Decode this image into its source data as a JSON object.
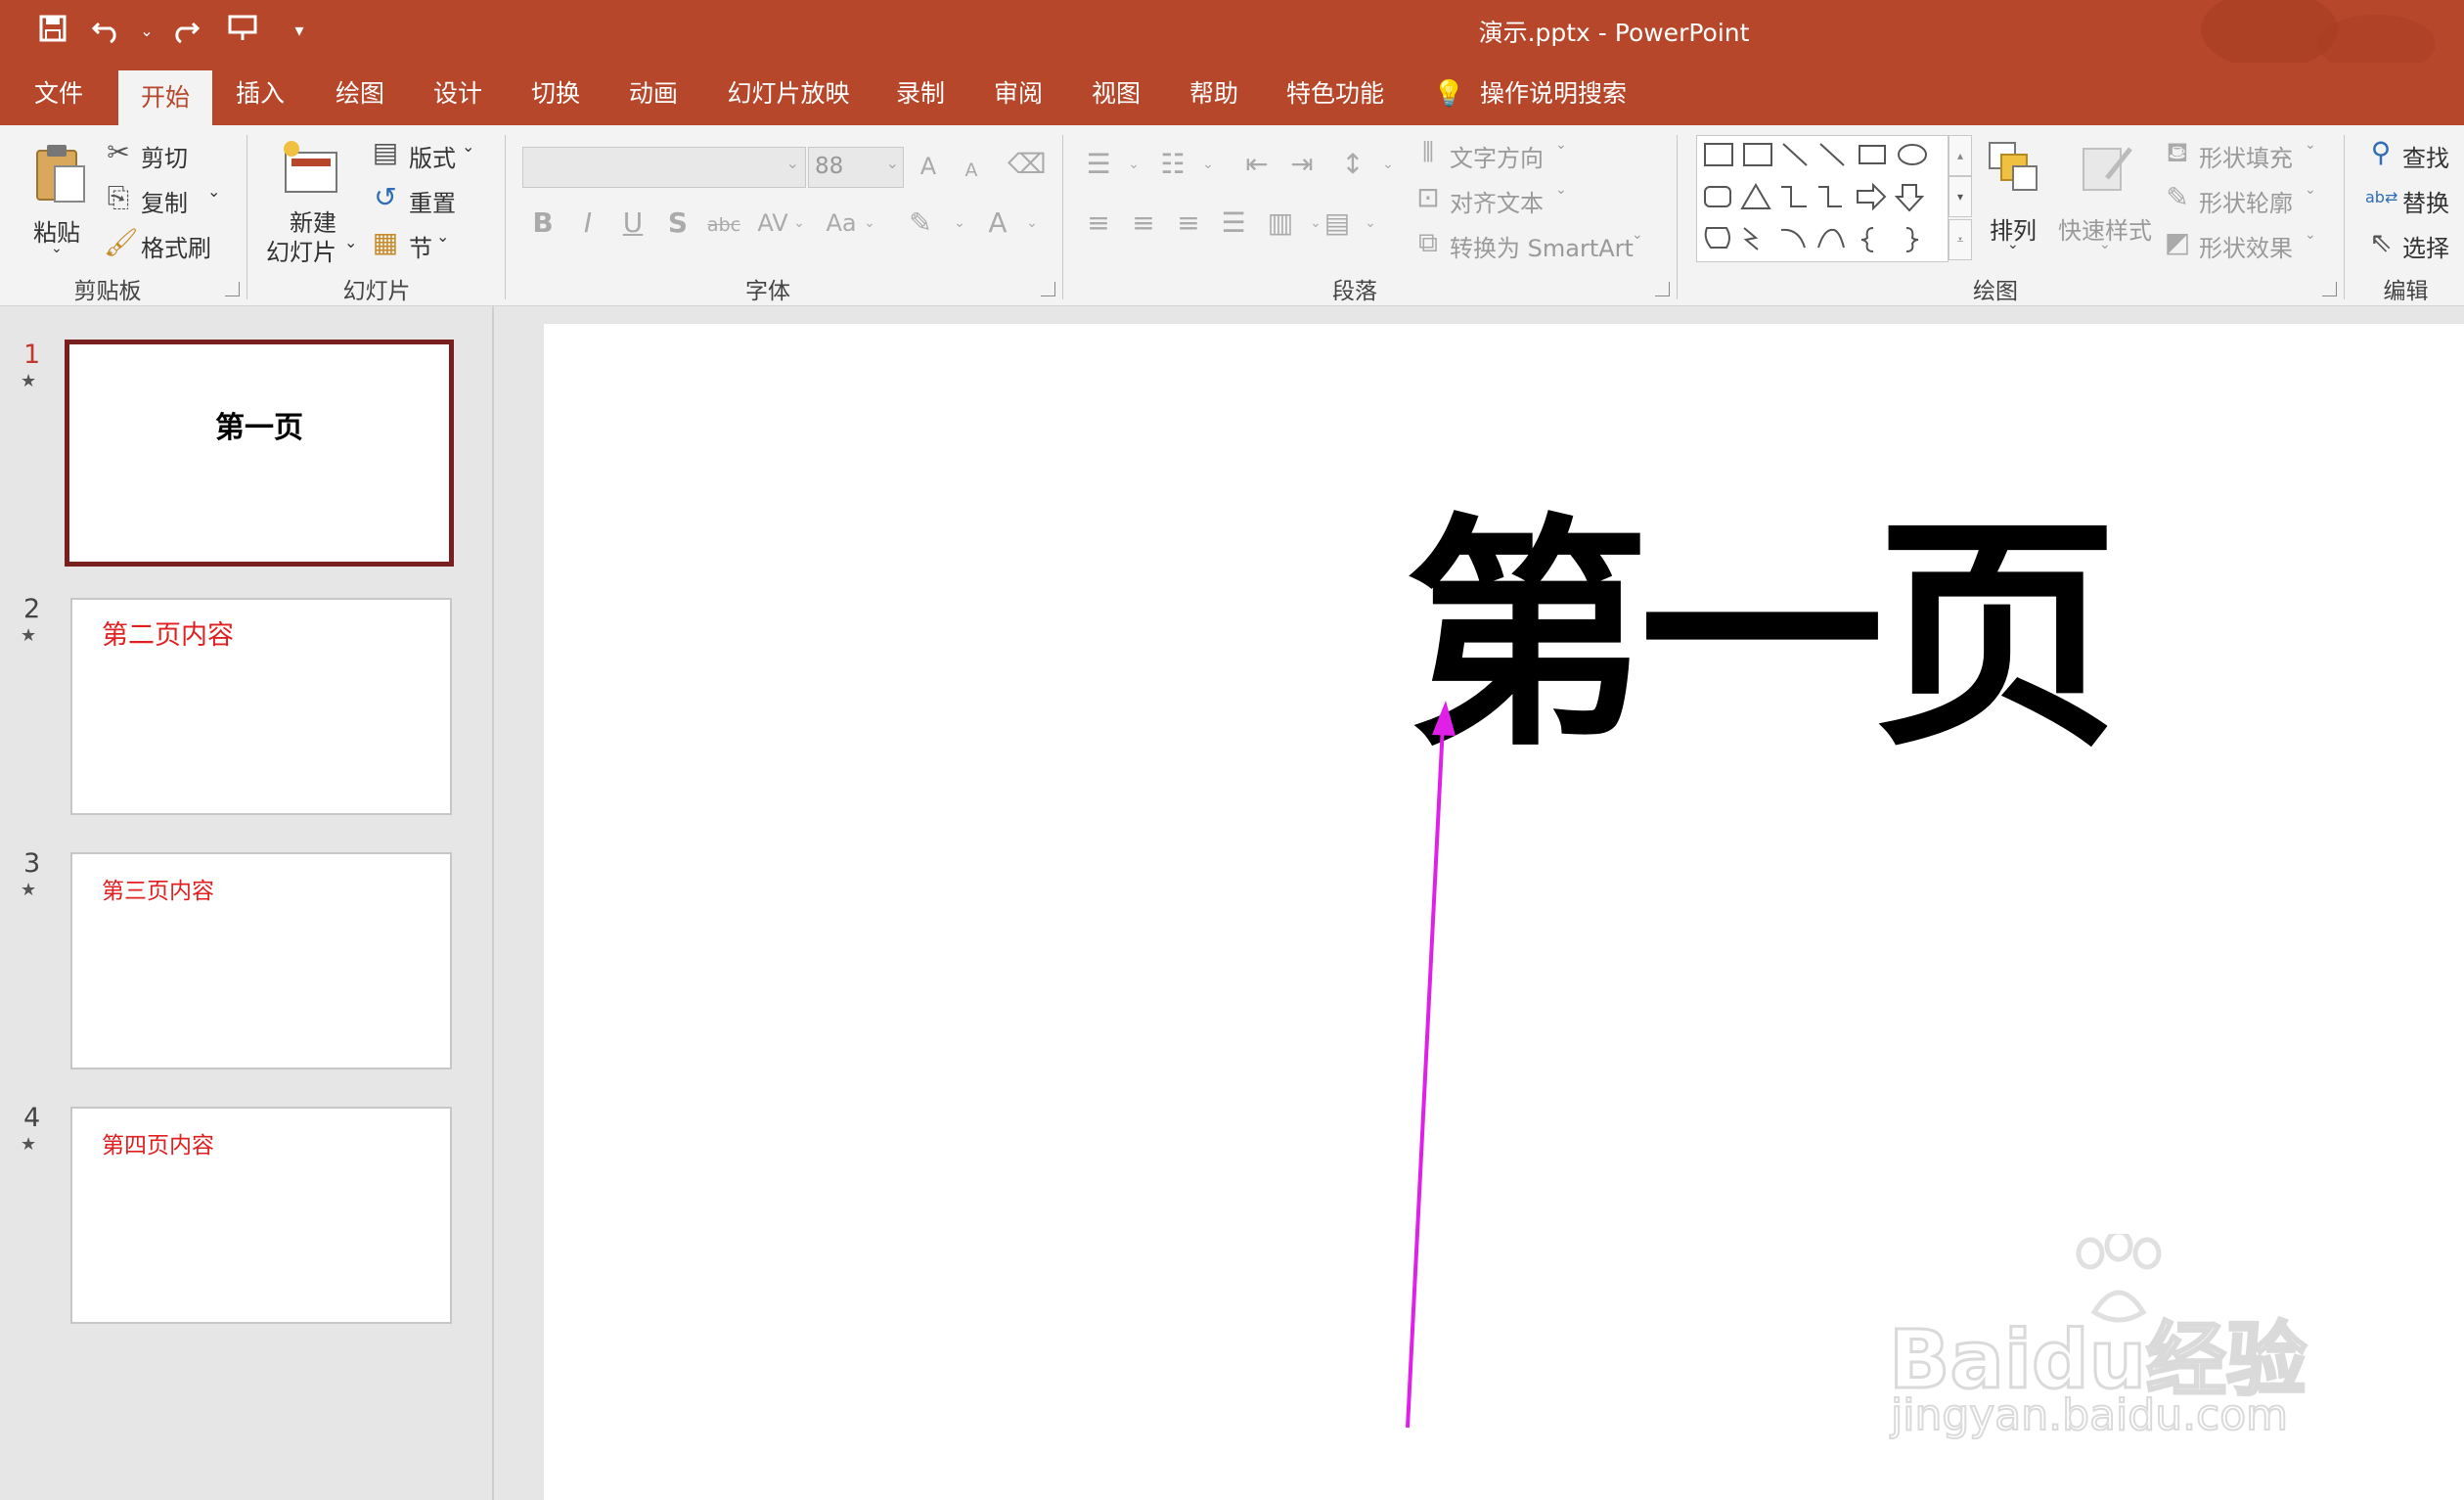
{
  "window": {
    "title": "演示.pptx  -  PowerPoint"
  },
  "qat": {
    "save_icon": "save-icon",
    "undo_icon": "undo-icon",
    "redo_icon": "redo-icon",
    "present_icon": "present-from-start-icon",
    "customize_icon": "customize-qat-icon"
  },
  "tabs": [
    "文件",
    "开始",
    "插入",
    "绘图",
    "设计",
    "切换",
    "动画",
    "幻灯片放映",
    "录制",
    "审阅",
    "视图",
    "帮助",
    "特色功能"
  ],
  "tell_me": "操作说明搜索",
  "ribbon": {
    "clipboard": {
      "label": "剪贴板",
      "paste": "粘贴",
      "cut": "剪切",
      "copy": "复制",
      "format_painter": "格式刷"
    },
    "slides": {
      "label": "幻灯片",
      "new_slide_line1": "新建",
      "new_slide_line2": "幻灯片",
      "layout": "版式",
      "reset": "重置",
      "section": "节"
    },
    "font": {
      "label": "字体",
      "font_name": "",
      "font_size": "88",
      "bold": "B",
      "italic": "I",
      "underline": "U",
      "shadow": "S",
      "strike": "abc",
      "spacing": "AV",
      "case": "Aa",
      "font_color": "A",
      "grow": "A",
      "shrink": "A"
    },
    "paragraph": {
      "label": "段落",
      "text_direction": "文字方向",
      "align_text": "对齐文本",
      "smartart": "转换为 SmartArt"
    },
    "drawing": {
      "label": "绘图",
      "arrange": "排列",
      "quick_styles": "快速样式",
      "shape_fill": "形状填充",
      "shape_outline": "形状轮廓",
      "shape_effects": "形状效果"
    },
    "editing": {
      "label": "编辑",
      "find": "查找",
      "replace": "替换",
      "select": "选择"
    }
  },
  "slides": [
    {
      "number": "1",
      "text": "第一页",
      "color": "#000000"
    },
    {
      "number": "2",
      "text": "第二页内容",
      "color": "#e02020"
    },
    {
      "number": "3",
      "text": "第三页内容",
      "color": "#e02020"
    },
    {
      "number": "4",
      "text": "第四页内容",
      "color": "#e02020"
    }
  ],
  "current_slide": {
    "title": "第一页"
  },
  "watermark": {
    "brand": "Baidu经验",
    "url": "jingyan.baidu.com"
  },
  "colors": {
    "accent": "#b7472a",
    "selected_border": "#7a1f1f",
    "annotation_arrow": "#e020e8"
  }
}
